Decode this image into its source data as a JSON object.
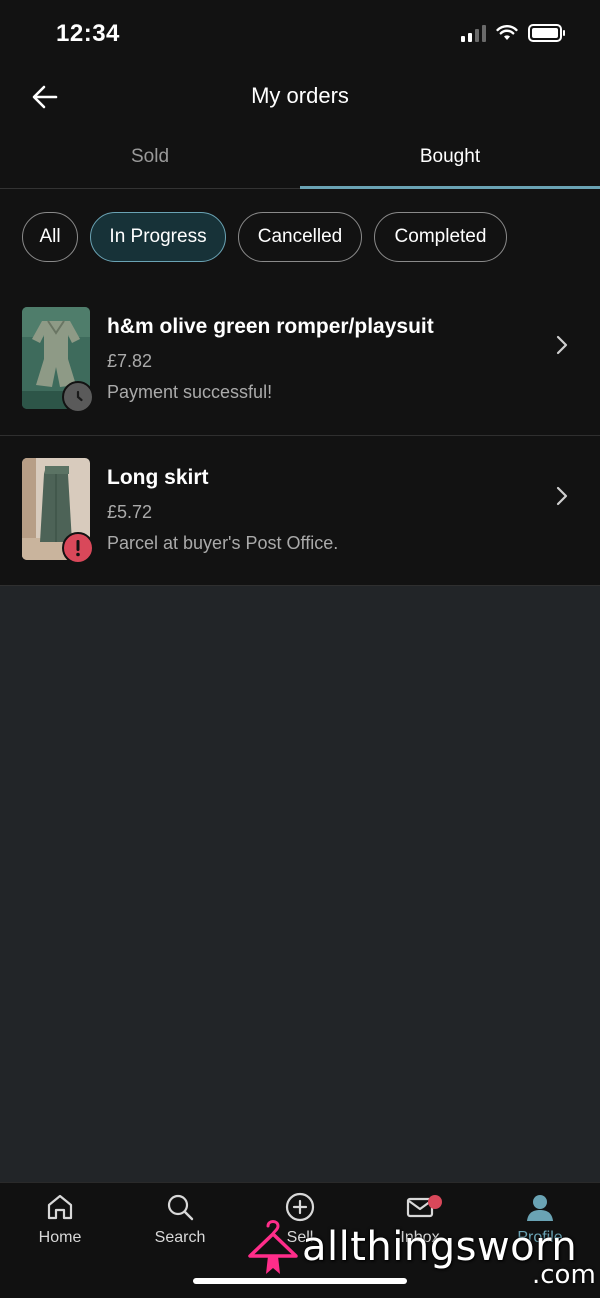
{
  "status_bar": {
    "time": "12:34"
  },
  "header": {
    "title": "My orders"
  },
  "tabs": [
    {
      "label": "Sold",
      "active": false
    },
    {
      "label": "Bought",
      "active": true
    }
  ],
  "filters": [
    {
      "label": "All",
      "active": false
    },
    {
      "label": "In Progress",
      "active": true
    },
    {
      "label": "Cancelled",
      "active": false
    },
    {
      "label": "Completed",
      "active": false
    }
  ],
  "orders": [
    {
      "name": "h&m olive green romper/playsuit",
      "price": "£7.82",
      "status": "Payment successful!",
      "status_icon": "clock-icon"
    },
    {
      "name": "Long skirt",
      "price": "£5.72",
      "status": "Parcel at buyer's Post Office.",
      "status_icon": "exclamation-icon"
    }
  ],
  "bottom_nav": [
    {
      "label": "Home",
      "icon": "home-icon"
    },
    {
      "label": "Search",
      "icon": "search-icon"
    },
    {
      "label": "Sell",
      "icon": "plus-circle-icon"
    },
    {
      "label": "Inbox",
      "icon": "mail-icon",
      "has_badge": true
    },
    {
      "label": "Profile",
      "icon": "profile-icon",
      "active": true
    }
  ],
  "watermark": {
    "text": "allthingsworn",
    "suffix": ".com"
  },
  "colors": {
    "accent": "#6aa3b4",
    "alert": "#d9485a",
    "background": "#121212",
    "empty_area": "#222528"
  }
}
